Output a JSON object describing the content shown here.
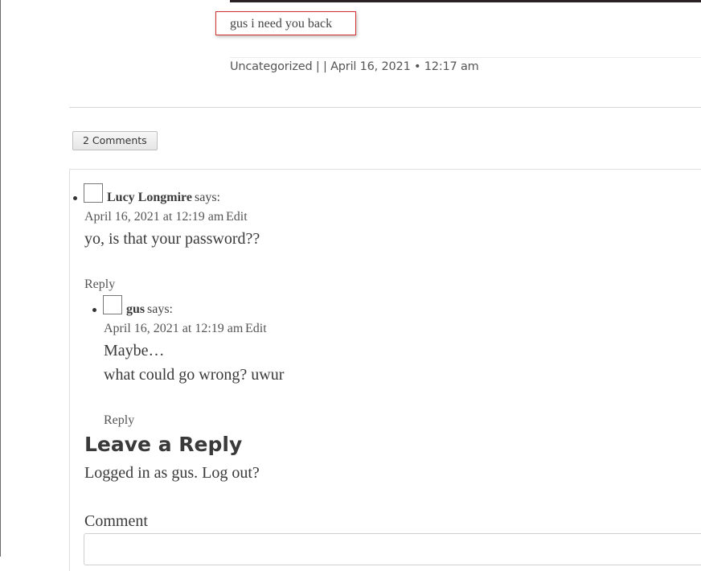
{
  "post": {
    "caption": "gus i need you back",
    "meta": {
      "category": "Uncategorized",
      "separator": " | | ",
      "date": "April 16, 2021",
      "dot": " • ",
      "time": "12:17 am"
    }
  },
  "comments_button": {
    "label": "2 Comments"
  },
  "comments": [
    {
      "author": "Lucy Longmire",
      "says": "says:",
      "date": "April 16, 2021 at 12:19 am",
      "edit": "Edit",
      "body": [
        "yo, is that your password??"
      ],
      "reply": "Reply"
    },
    {
      "author": "gus",
      "says": "says:",
      "date": "April 16, 2021 at 12:19 am",
      "edit": "Edit",
      "body": [
        "Maybe…",
        "what could go wrong? uwur"
      ],
      "reply": "Reply"
    }
  ],
  "reply_form": {
    "heading": "Leave a Reply",
    "logged_in_prefix": "Logged in as ",
    "user": "gus",
    "period": ".",
    "logout": "Log out?",
    "comment_label": "Comment",
    "comment_value": ""
  },
  "colors": {
    "caption_border": "#d22f2f",
    "text": "#3a3a3a"
  }
}
